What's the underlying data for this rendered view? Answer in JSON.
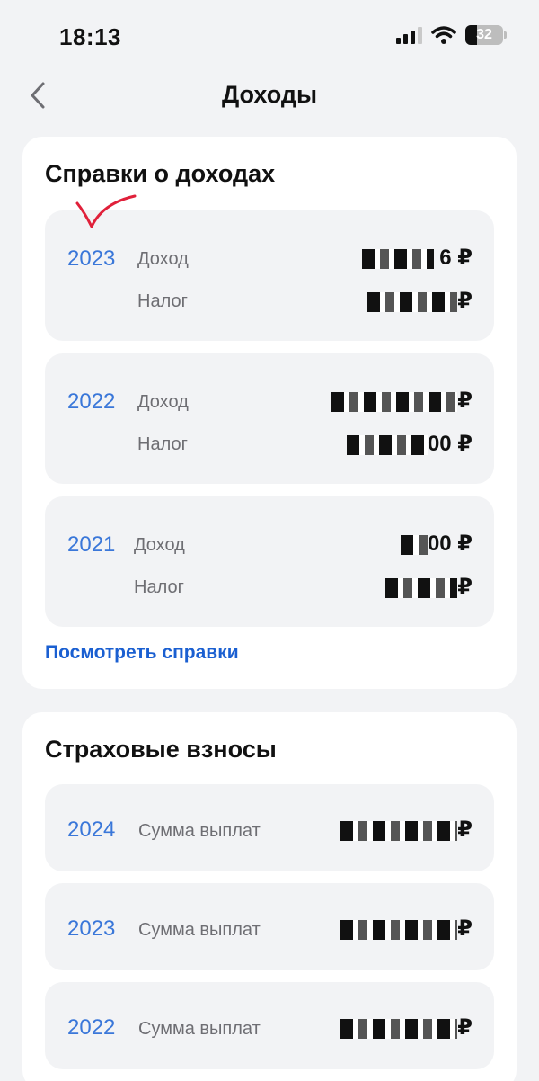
{
  "status": {
    "time": "18:13",
    "battery": "32"
  },
  "nav": {
    "title": "Доходы"
  },
  "income": {
    "title": "Справки о доходах",
    "rows": [
      {
        "year": "2023",
        "income_label": "Доход",
        "income_value": "6 ₽",
        "tax_label": "Налог",
        "tax_value": "₽"
      },
      {
        "year": "2022",
        "income_label": "Доход",
        "income_value": "₽",
        "tax_label": "Налог",
        "tax_value": "00 ₽"
      },
      {
        "year": "2021",
        "income_label": "Доход",
        "income_value": "00 ₽",
        "tax_label": "Налог",
        "tax_value": "₽"
      }
    ],
    "link": "Посмотреть справки"
  },
  "insurance": {
    "title": "Страховые взносы",
    "rows": [
      {
        "year": "2024",
        "label": "Сумма выплат",
        "value": "₽"
      },
      {
        "year": "2023",
        "label": "Сумма выплат",
        "value": "₽"
      },
      {
        "year": "2022",
        "label": "Сумма выплат",
        "value": "₽"
      }
    ]
  },
  "colors": {
    "accent": "#3a77d9",
    "link": "#1a5fd1",
    "background": "#f2f3f5"
  }
}
